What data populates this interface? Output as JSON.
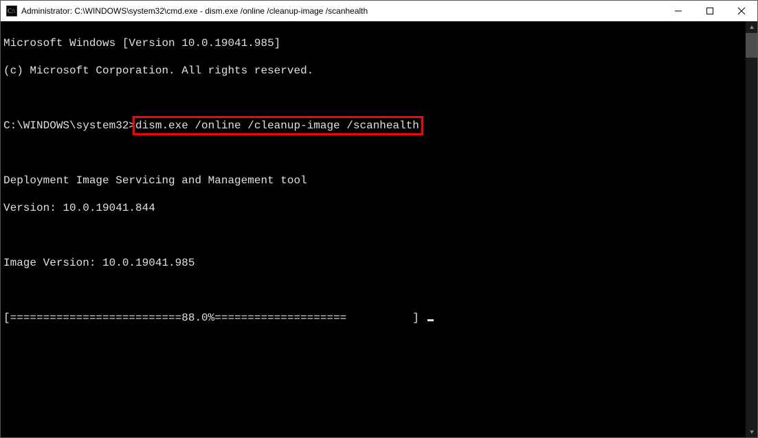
{
  "titlebar": {
    "icon": "cmd-icon",
    "title": "Administrator: C:\\WINDOWS\\system32\\cmd.exe - dism.exe  /online /cleanup-image /scanhealth"
  },
  "terminal": {
    "banner_line1": "Microsoft Windows [Version 10.0.19041.985]",
    "banner_line2": "(c) Microsoft Corporation. All rights reserved.",
    "prompt_prefix": "C:\\WINDOWS\\system32>",
    "command": "dism.exe /online /cleanup-image /scanhealth",
    "tool_line1": "Deployment Image Servicing and Management tool",
    "tool_line2": "Version: 10.0.19041.844",
    "image_version": "Image Version: 10.0.19041.985",
    "progress": "[==========================88.0%====================          ] "
  }
}
